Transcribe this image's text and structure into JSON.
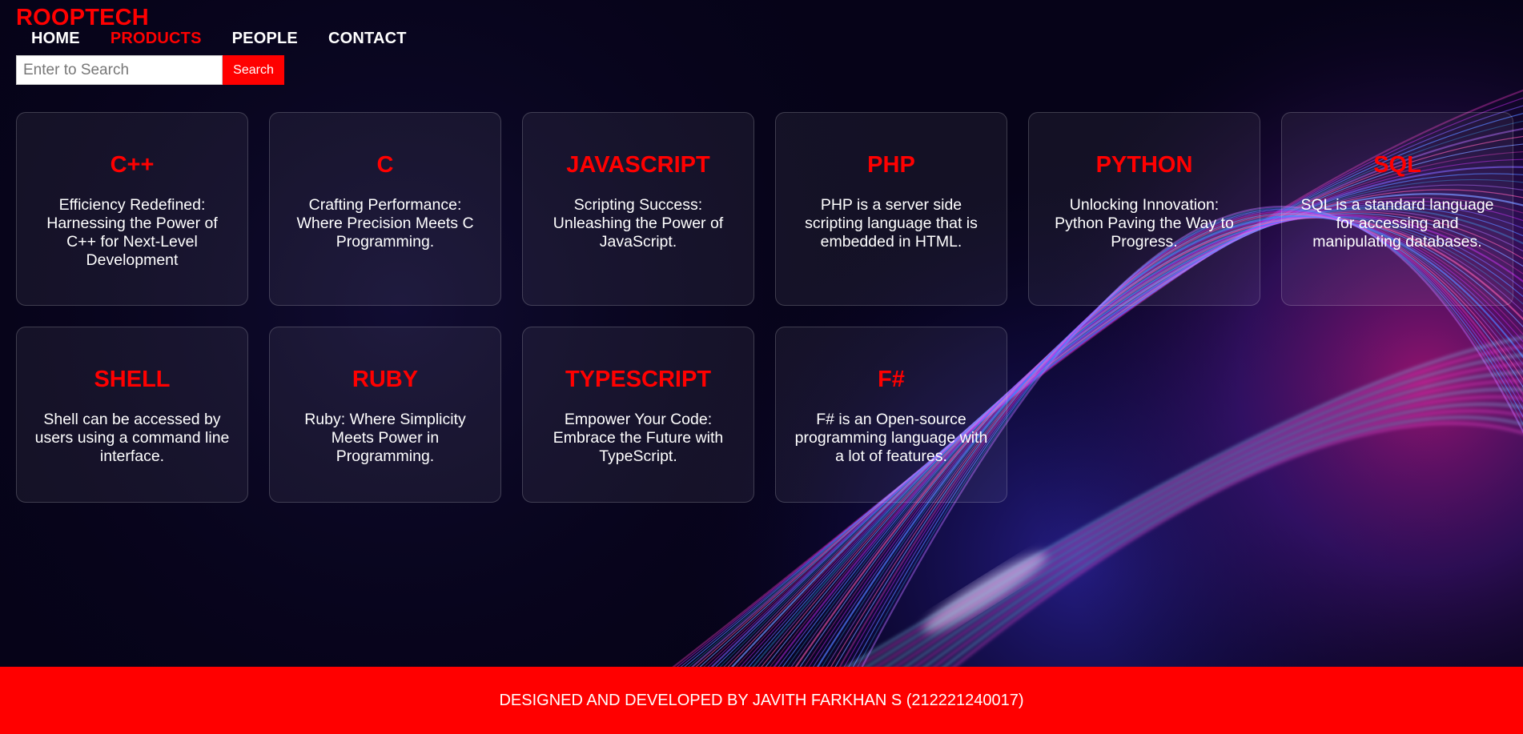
{
  "brand": "ROOPTECH",
  "nav": {
    "home": "HOME",
    "products": "PRODUCTS",
    "people": "PEOPLE",
    "contact": "CONTACT"
  },
  "search": {
    "placeholder": "Enter to Search",
    "button_label": "Search"
  },
  "cards": [
    {
      "title": "C++",
      "text": "Efficiency Redefined: Harnessing the Power of C++ for Next-Level Development"
    },
    {
      "title": "C",
      "text": "Crafting Performance: Where Precision Meets C Programming."
    },
    {
      "title": "JAVASCRIPT",
      "text": "Scripting Success: Unleashing the Power of JavaScript."
    },
    {
      "title": "PHP",
      "text": "PHP is a server side scripting language that is embedded in HTML."
    },
    {
      "title": "PYTHON",
      "text": "Unlocking Innovation: Python Paving the Way to Progress."
    },
    {
      "title": "SQL",
      "text": "SQL is a standard language for accessing and manipulating databases."
    },
    {
      "title": "SHELL",
      "text": "Shell can be accessed by users using a command line interface."
    },
    {
      "title": "RUBY",
      "text": "Ruby: Where Simplicity Meets Power in Programming."
    },
    {
      "title": "TYPESCRIPT",
      "text": "Empower Your Code: Embrace the Future with TypeScript."
    },
    {
      "title": "F#",
      "text": "F# is an Open-source programming language with a lot of features."
    }
  ],
  "footer": "DESIGNED AND DEVELOPED BY JAVITH FARKHAN S (212221240017)",
  "colors": {
    "accent": "#ff0000",
    "background": "#060318",
    "text": "#ffffff"
  }
}
